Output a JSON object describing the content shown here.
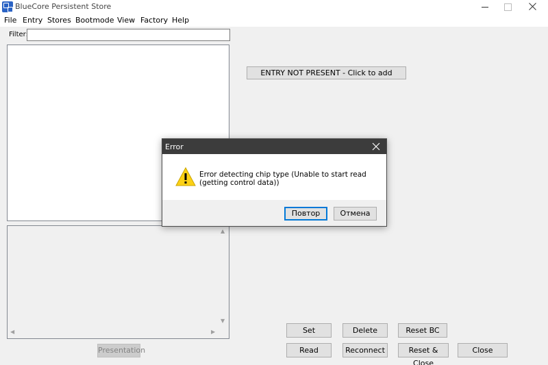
{
  "window": {
    "title": "BlueCore Persistent Store"
  },
  "menu": {
    "items": [
      "File",
      "Entry",
      "Stores",
      "Bootmode",
      "View",
      "Factory",
      "Help"
    ]
  },
  "filter": {
    "label": "Filter:",
    "value": ""
  },
  "entry": {
    "button_label": "ENTRY NOT PRESENT - Click to add"
  },
  "bottom": {
    "presentation_label": "Presentation"
  },
  "actions": {
    "set": "Set",
    "delete": "Delete",
    "reset_bc": "Reset BC",
    "read": "Read",
    "reconnect": "Reconnect",
    "reset_close": "Reset & Close",
    "close": "Close"
  },
  "dialog": {
    "title": "Error",
    "message": "Error detecting chip type (Unable to start read (getting control data))",
    "retry_label": "Повтор",
    "cancel_label": "Отмена",
    "icon": "warning-icon"
  },
  "colors": {
    "dialog_titlebar": "#3c3c3c",
    "default_button_border": "#0078d7",
    "warning_fill": "#fcd116"
  }
}
